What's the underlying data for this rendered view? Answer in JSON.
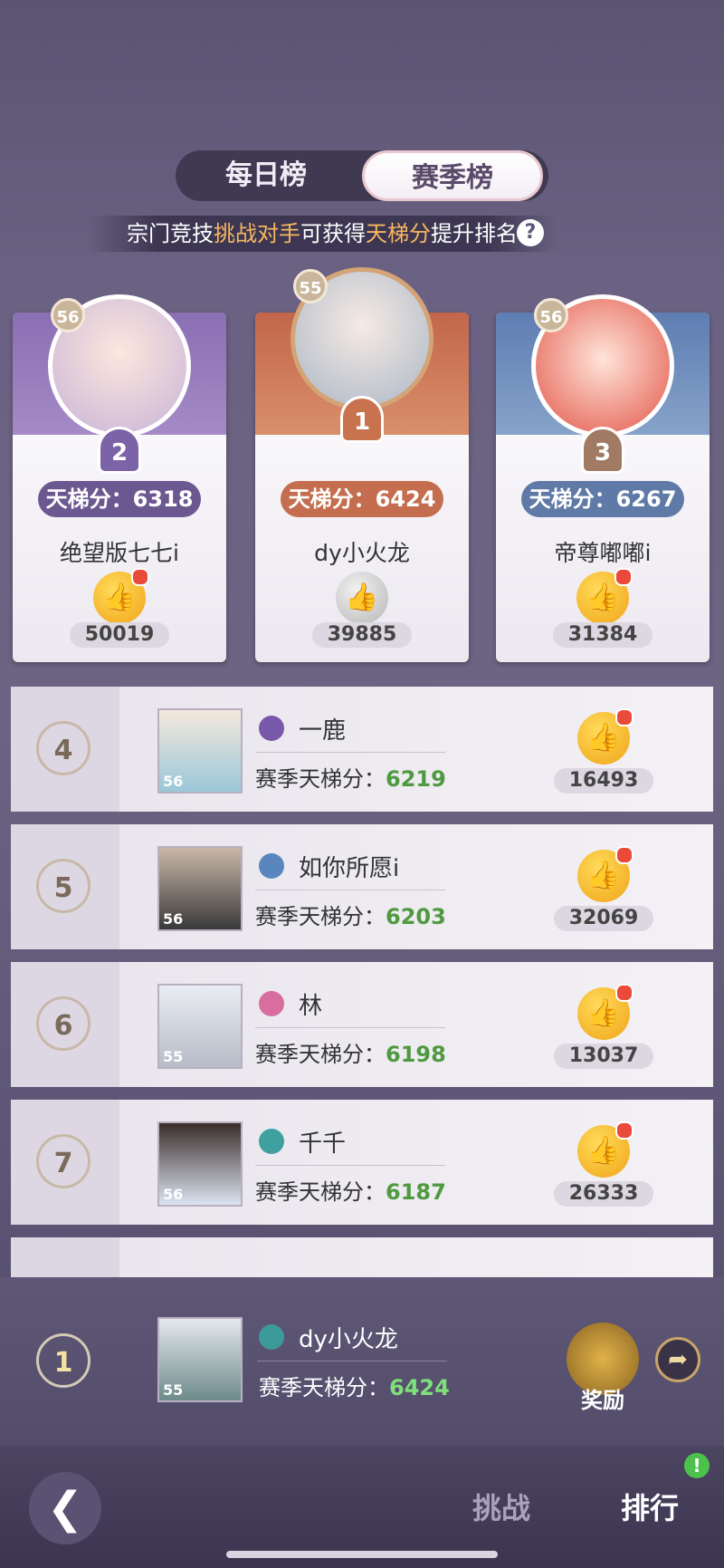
{
  "tabs": {
    "daily": "每日榜",
    "season": "赛季榜"
  },
  "hint": {
    "p1": "宗门竞技",
    "p2": "挑战对手",
    "p3": "可获得",
    "p4": "天梯分",
    "p5": "提升排名",
    "help": "?"
  },
  "podium": [
    {
      "rank": "2",
      "level": "56",
      "score_label": "天梯分：6318",
      "name": "绝望版七七i",
      "likes": "50019"
    },
    {
      "rank": "1",
      "level": "55",
      "score_label": "天梯分：6424",
      "name": "dy小火龙",
      "likes": "39885"
    },
    {
      "rank": "3",
      "level": "56",
      "score_label": "天梯分：6267",
      "name": "帝尊嘟嘟i",
      "likes": "31384"
    }
  ],
  "rows": [
    {
      "rank": "4",
      "level": "56",
      "name": "一鹿",
      "score_prefix": "赛季天梯分：",
      "score": "6219",
      "likes": "16493"
    },
    {
      "rank": "5",
      "level": "56",
      "name": "如你所愿i",
      "score_prefix": "赛季天梯分：",
      "score": "6203",
      "likes": "32069"
    },
    {
      "rank": "6",
      "level": "55",
      "name": "林",
      "score_prefix": "赛季天梯分：",
      "score": "6198",
      "likes": "13037"
    },
    {
      "rank": "7",
      "level": "56",
      "name": "千千",
      "score_prefix": "赛季天梯分：",
      "score": "6187",
      "likes": "26333"
    }
  ],
  "me": {
    "rank": "1",
    "level": "55",
    "name": "dy小火龙",
    "score_prefix": "赛季天梯分：",
    "score": "6424",
    "reward": "奖励"
  },
  "nav": {
    "challenge": "挑战",
    "ranking": "排行",
    "alert": "!"
  },
  "colors": {
    "highlight": "#f7b760",
    "score_green": "#4f9a40",
    "rank1": "#c8734e",
    "rank2": "#7c62a6",
    "rank3": "#6f89b0"
  }
}
